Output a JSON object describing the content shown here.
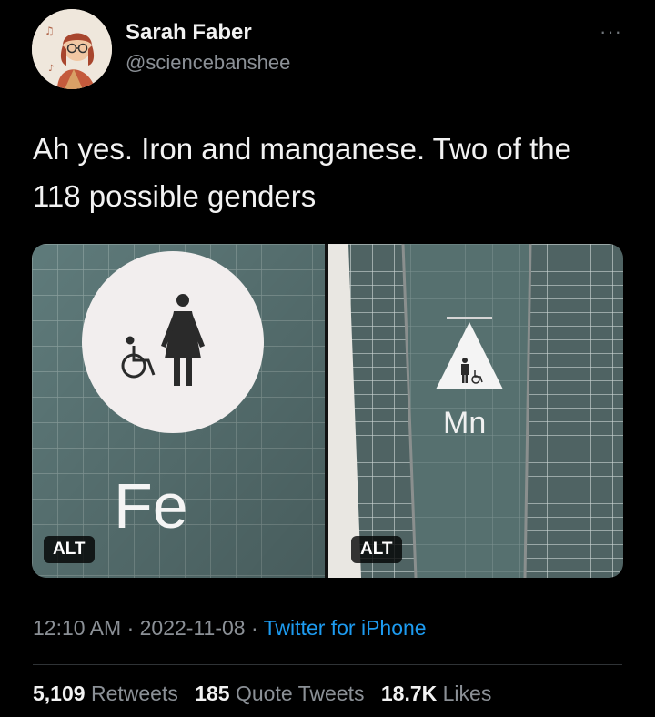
{
  "author": {
    "display_name": "Sarah Faber",
    "handle": "@sciencebanshee"
  },
  "tweet": {
    "text": "Ah yes. Iron and manganese. Two of the 118 possible genders"
  },
  "media": [
    {
      "sign_text": "Fe",
      "alt_label": "ALT"
    },
    {
      "sign_text": "Mn",
      "alt_label": "ALT"
    }
  ],
  "meta": {
    "time": "12:10 AM",
    "separator": " · ",
    "date": "2022-11-08",
    "source": "Twitter for iPhone"
  },
  "stats": {
    "retweets": {
      "count": "5,109",
      "label": "Retweets"
    },
    "quote_tweets": {
      "count": "185",
      "label": "Quote Tweets"
    },
    "likes": {
      "count": "18.7K",
      "label": "Likes"
    }
  },
  "icons": {
    "more": "more-icon",
    "wheelchair": "wheelchair-icon",
    "woman": "woman-icon",
    "man": "man-icon"
  }
}
